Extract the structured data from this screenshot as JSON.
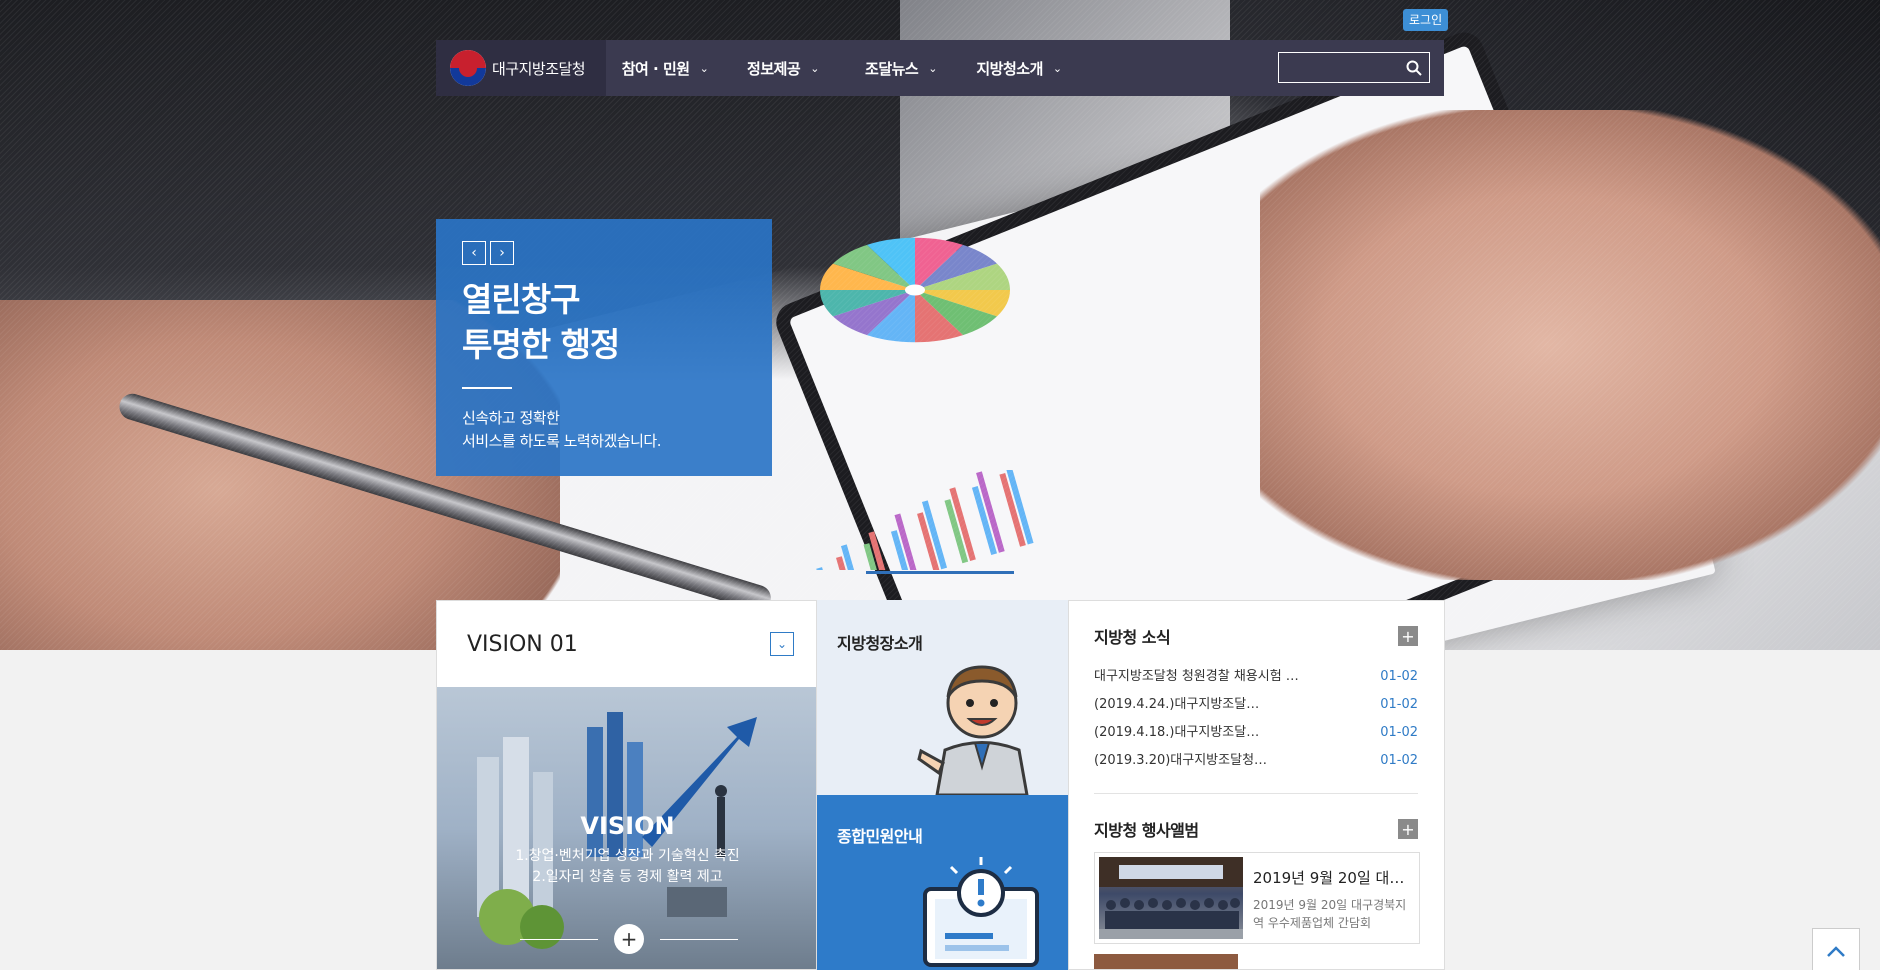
{
  "header": {
    "login_label": "로그인",
    "logo_text": "대구지방조달청",
    "menu": [
      {
        "label": "참여 · 민원"
      },
      {
        "label": "정보제공"
      },
      {
        "label": "조달뉴스"
      },
      {
        "label": "지방청소개"
      }
    ],
    "search": {
      "value": "",
      "placeholder": ""
    }
  },
  "slide": {
    "title_line1": "열린창구",
    "title_line2": "투명한 행정",
    "desc_line1": "신속하고 정확한",
    "desc_line2": "서비스를 하도록 노력하겠습니다."
  },
  "vision": {
    "heading": "VISION 01",
    "caption_title": "VISION",
    "caption_line1": "1.창업·벤처기업 성장과 기술혁신 촉진",
    "caption_line2": "2.일자리 창출 등 경제 활력 제고"
  },
  "tiles": {
    "intro": "지방청장소개",
    "civil": "종합민원안내"
  },
  "news": {
    "heading": "지방청 소식",
    "items": [
      {
        "title": "대구지방조달청 청원경찰 채용시험 …",
        "date": "01-02"
      },
      {
        "title": "(2019.4.24.)대구지방조달…",
        "date": "01-02"
      },
      {
        "title": "(2019.4.18.)대구지방조달…",
        "date": "01-02"
      },
      {
        "title": "(2019.3.20)대구지방조달청…",
        "date": "01-02"
      }
    ]
  },
  "album": {
    "heading": "지방청 행사앨범",
    "item": {
      "title": "2019년 9월 20일 대구…",
      "desc": "2019년 9월 20일 대구경북지역 우수제품업체 간담회"
    }
  },
  "colors": {
    "gnb_bg": "#3b3a50",
    "accent_blue": "#2e7bc9",
    "login_badge": "#3d8fd6"
  }
}
